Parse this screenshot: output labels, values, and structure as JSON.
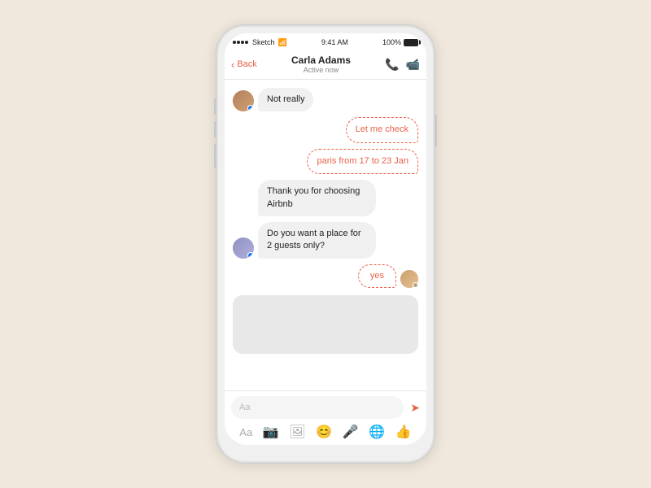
{
  "phone": {
    "statusBar": {
      "carrier": "●●●●",
      "appName": "Sketch",
      "time": "9:41 AM",
      "battery": "100%"
    },
    "header": {
      "backLabel": "Back",
      "contactName": "Carla Adams",
      "contactStatus": "Active now"
    },
    "messages": [
      {
        "id": "msg1",
        "side": "left",
        "text": "Not really",
        "hasAvatar": true
      },
      {
        "id": "msg2",
        "side": "right",
        "text": "Let me check"
      },
      {
        "id": "msg3",
        "side": "right",
        "text": "paris from 17 to 23 Jan"
      },
      {
        "id": "msg4",
        "side": "left",
        "text": "Thank you for choosing Airbnb",
        "hasAvatar": false
      },
      {
        "id": "msg5",
        "side": "left",
        "text": "Do you want a place for 2 guests only?",
        "hasAvatar": true
      },
      {
        "id": "msg6",
        "side": "right",
        "text": "yes",
        "hasSmallAvatar": true
      }
    ],
    "inputArea": {
      "placeholder": "Aa",
      "icons": [
        "📷",
        "🖼",
        "😊",
        "🎤",
        "🌐",
        "👍"
      ]
    }
  }
}
